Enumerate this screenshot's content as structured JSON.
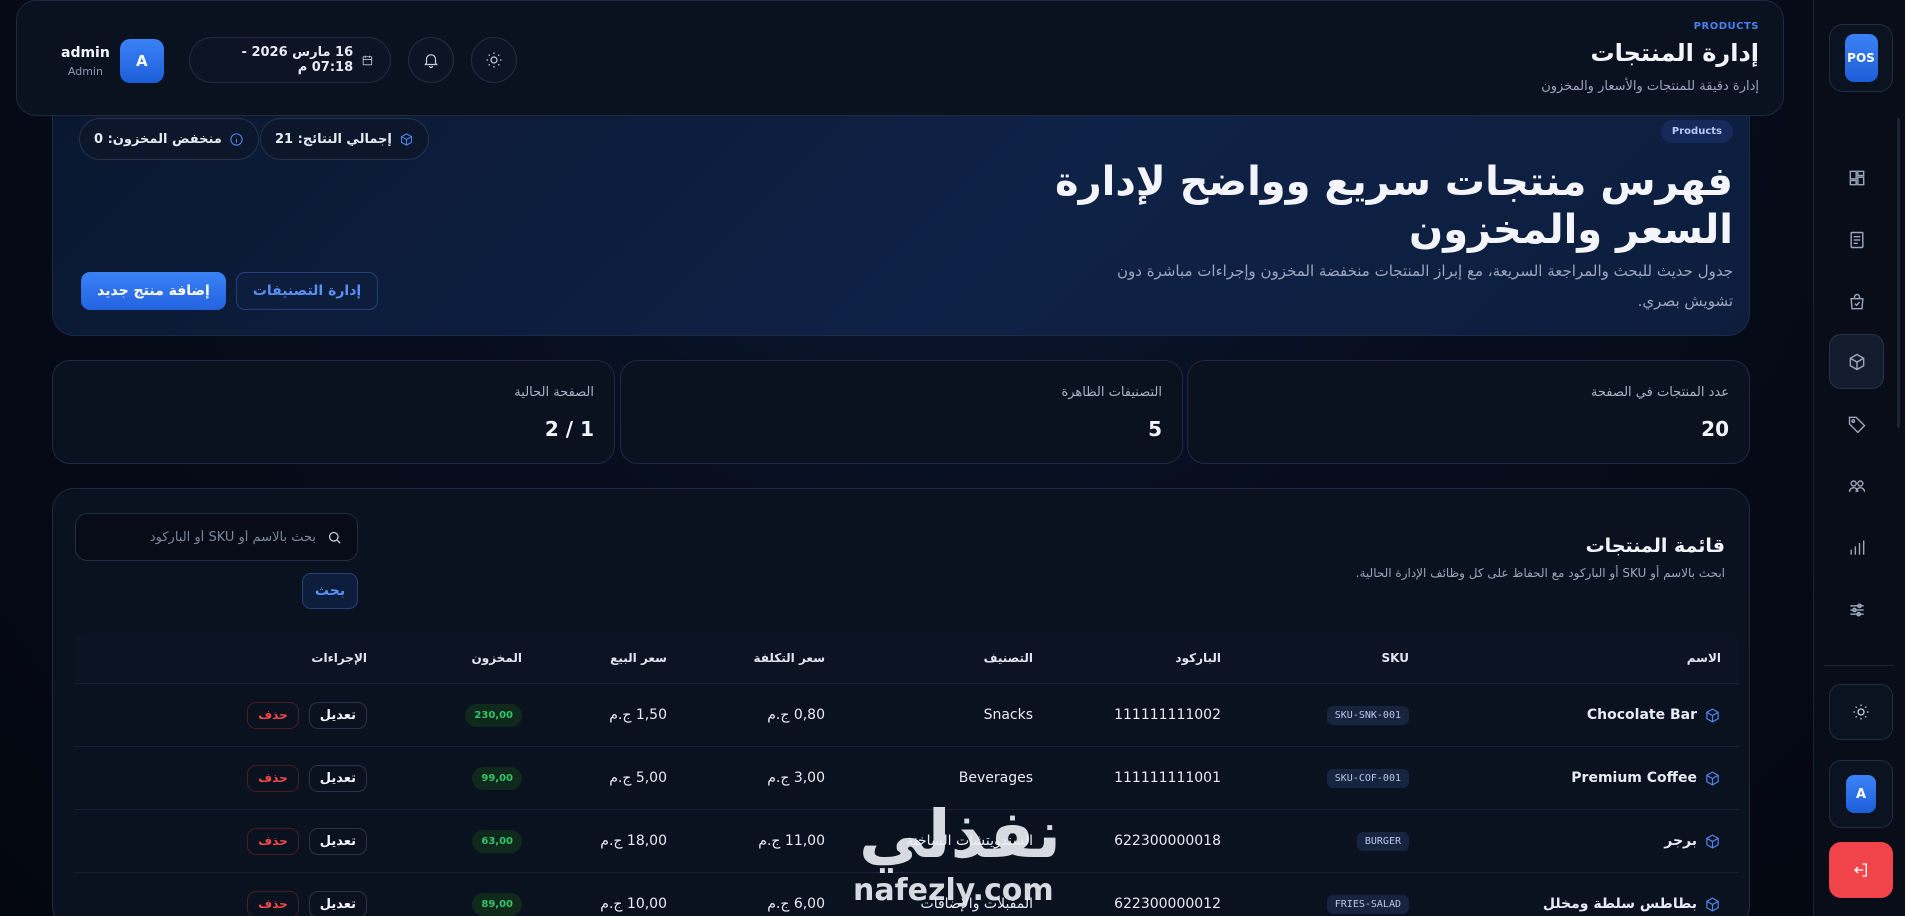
{
  "sidebar": {
    "logo": "POS",
    "nav": [
      {
        "icon": "dashboard-icon"
      },
      {
        "icon": "receipt-icon"
      },
      {
        "icon": "shopping-bag-icon"
      },
      {
        "icon": "box-icon"
      },
      {
        "icon": "tag-icon"
      },
      {
        "icon": "users-icon"
      },
      {
        "icon": "bar-chart-icon"
      },
      {
        "icon": "sliders-icon"
      }
    ],
    "active_index": 3,
    "theme_icon": "sun-icon",
    "user_initial": "A",
    "logout_icon": "logout-icon"
  },
  "topbar": {
    "badge": "PRODUCTS",
    "title": "إدارة المنتجات",
    "subtitle": "إدارة دقيقة للمنتجات والأسعار والمخزون",
    "date_text": "16 مارس 2026 - 07:18 م",
    "user_name": "admin",
    "user_role": "Admin",
    "user_initial": "A"
  },
  "hero": {
    "badge": "Products",
    "title": "فهرس منتجات سريع وواضح لإدارة السعر والمخزون",
    "description": "جدول حديث للبحث والمراجعة السريعة، مع إبراز المنتجات منخفضة المخزون وإجراءات مباشرة دون تشويش بصري.",
    "total_results": "إجمالي النتائج: 21",
    "low_stock": "منخفض المخزون: 0",
    "add_button": "إضافة منتج جديد",
    "categories_button": "إدارة التصنيفات"
  },
  "stats": [
    {
      "label": "عدد المنتجات في الصفحة",
      "value": "20"
    },
    {
      "label": "التصنيفات الظاهرة",
      "value": "5"
    },
    {
      "label": "الصفحة الحالية",
      "value": "1 / 2"
    }
  ],
  "products_panel": {
    "title": "قائمة المنتجات",
    "subtitle": "ابحث بالاسم أو SKU أو الباركود مع الحفاظ على كل وظائف الإدارة الحالية.",
    "search_placeholder": "بحث بالاسم أو SKU أو الباركود",
    "search_value": "",
    "search_button": "بحث",
    "columns": [
      "الاسم",
      "SKU",
      "الباركود",
      "التصنيف",
      "سعر التكلفة",
      "سعر البيع",
      "المخزون",
      "الإجراءات"
    ],
    "rows": [
      {
        "name": "Chocolate Bar",
        "sku": "SKU-SNK-001",
        "barcode": "111111111002",
        "category": "Snacks",
        "cost": "0,80 ج.م",
        "price": "1,50 ج.م",
        "stock": "230,00",
        "edit": "تعديل",
        "delete": "حذف"
      },
      {
        "name": "Premium Coffee",
        "sku": "SKU-COF-001",
        "barcode": "111111111001",
        "category": "Beverages",
        "cost": "3,00 ج.م",
        "price": "5,00 ج.م",
        "stock": "99,00",
        "edit": "تعديل",
        "delete": "حذف"
      },
      {
        "name": "برجر",
        "sku": "BURGER",
        "barcode": "622300000018",
        "category": "السندويتشات الساخنة",
        "cost": "11,00 ج.م",
        "price": "18,00 ج.م",
        "stock": "63,00",
        "edit": "تعديل",
        "delete": "حذف"
      },
      {
        "name": "بطاطس سلطة ومخلل",
        "sku": "FRIES-SALAD",
        "barcode": "622300000012",
        "category": "المقبلات والإضافات",
        "cost": "6,00 ج.م",
        "price": "10,00 ج.م",
        "stock": "89,00",
        "edit": "تعديل",
        "delete": "حذف"
      }
    ]
  },
  "watermark": {
    "arabic": "نفذلي",
    "latin": "nafezly.com"
  },
  "colors": {
    "accent": "#3b82f6",
    "danger": "#f04a4a",
    "success": "#34c46b",
    "background": "#070d1d"
  }
}
